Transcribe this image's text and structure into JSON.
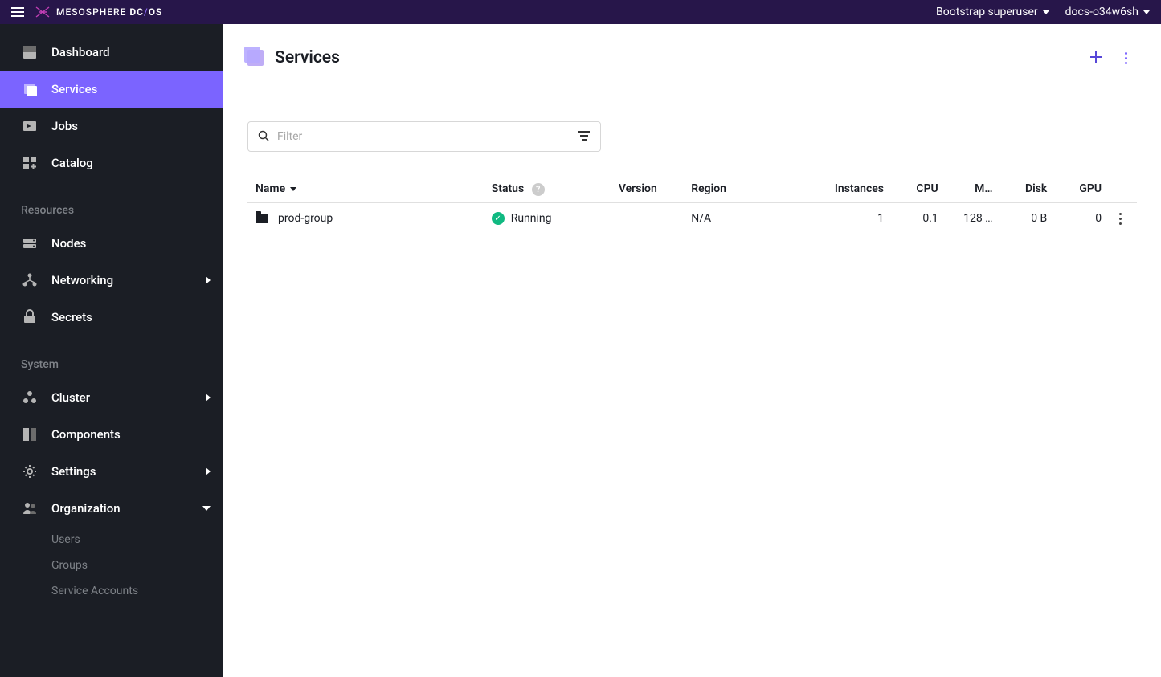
{
  "topbar": {
    "brand_text_1": "MESOSPHERE",
    "brand_text_2": "DC",
    "brand_text_3": "OS",
    "user_label": "Bootstrap superuser",
    "cluster_label": "docs-o34w6sh"
  },
  "sidebar": {
    "items_main": [
      {
        "label": "Dashboard",
        "icon": "dashboard-icon",
        "active": false,
        "arrow": ""
      },
      {
        "label": "Services",
        "icon": "services-icon",
        "active": true,
        "arrow": ""
      },
      {
        "label": "Jobs",
        "icon": "jobs-icon",
        "active": false,
        "arrow": ""
      },
      {
        "label": "Catalog",
        "icon": "catalog-icon",
        "active": false,
        "arrow": ""
      }
    ],
    "section_resources": "Resources",
    "items_resources": [
      {
        "label": "Nodes",
        "icon": "nodes-icon",
        "arrow": ""
      },
      {
        "label": "Networking",
        "icon": "networking-icon",
        "arrow": "right"
      },
      {
        "label": "Secrets",
        "icon": "secrets-icon",
        "arrow": ""
      }
    ],
    "section_system": "System",
    "items_system": [
      {
        "label": "Cluster",
        "icon": "cluster-icon",
        "arrow": "right"
      },
      {
        "label": "Components",
        "icon": "components-icon",
        "arrow": ""
      },
      {
        "label": "Settings",
        "icon": "settings-icon",
        "arrow": "right"
      },
      {
        "label": "Organization",
        "icon": "organization-icon",
        "arrow": "down"
      }
    ],
    "sub_organization": [
      {
        "label": "Users"
      },
      {
        "label": "Groups"
      },
      {
        "label": "Service Accounts"
      }
    ]
  },
  "page": {
    "title": "Services"
  },
  "filter": {
    "placeholder": "Filter"
  },
  "table": {
    "columns": {
      "name": "Name",
      "status": "Status",
      "version": "Version",
      "region": "Region",
      "instances": "Instances",
      "cpu": "CPU",
      "mem": "M…",
      "disk": "Disk",
      "gpu": "GPU"
    },
    "rows": [
      {
        "name": "prod-group",
        "status": "Running",
        "version": "",
        "region": "N/A",
        "instances": "1",
        "cpu": "0.1",
        "mem": "128 …",
        "disk": "0 B",
        "gpu": "0"
      }
    ]
  }
}
